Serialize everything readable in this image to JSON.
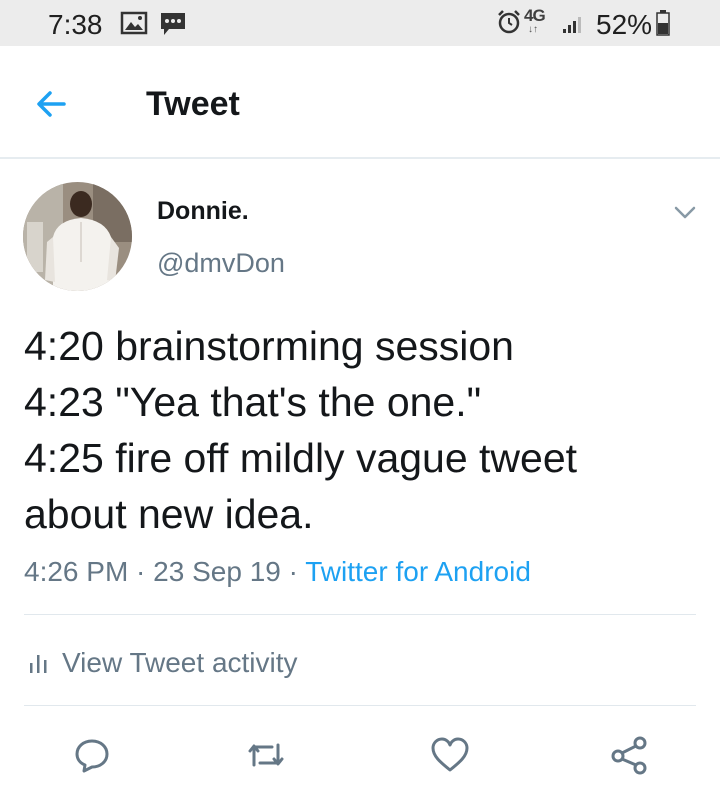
{
  "status_bar": {
    "time": "7:38",
    "network": "4G",
    "battery": "52%"
  },
  "header": {
    "title": "Tweet"
  },
  "tweet": {
    "author_name": "Donnie.",
    "author_handle": "@dmvDon",
    "text_lines": [
      "4:20 brainstorming session",
      "4:23 \"Yea that's the one.\"",
      "4:25 fire off mildly vague tweet",
      "about new idea."
    ],
    "time": "4:26 PM",
    "separator": " · ",
    "date": "23 Sep 19",
    "source": "Twitter for Android",
    "activity_label": "View Tweet activity"
  },
  "actions": [
    "reply-icon",
    "retweet-icon",
    "like-icon",
    "share-icon"
  ],
  "colors": {
    "accent": "#1da1f2",
    "secondary_text": "#657786",
    "primary_text": "#14171a",
    "status_bar_bg": "#ececec"
  }
}
